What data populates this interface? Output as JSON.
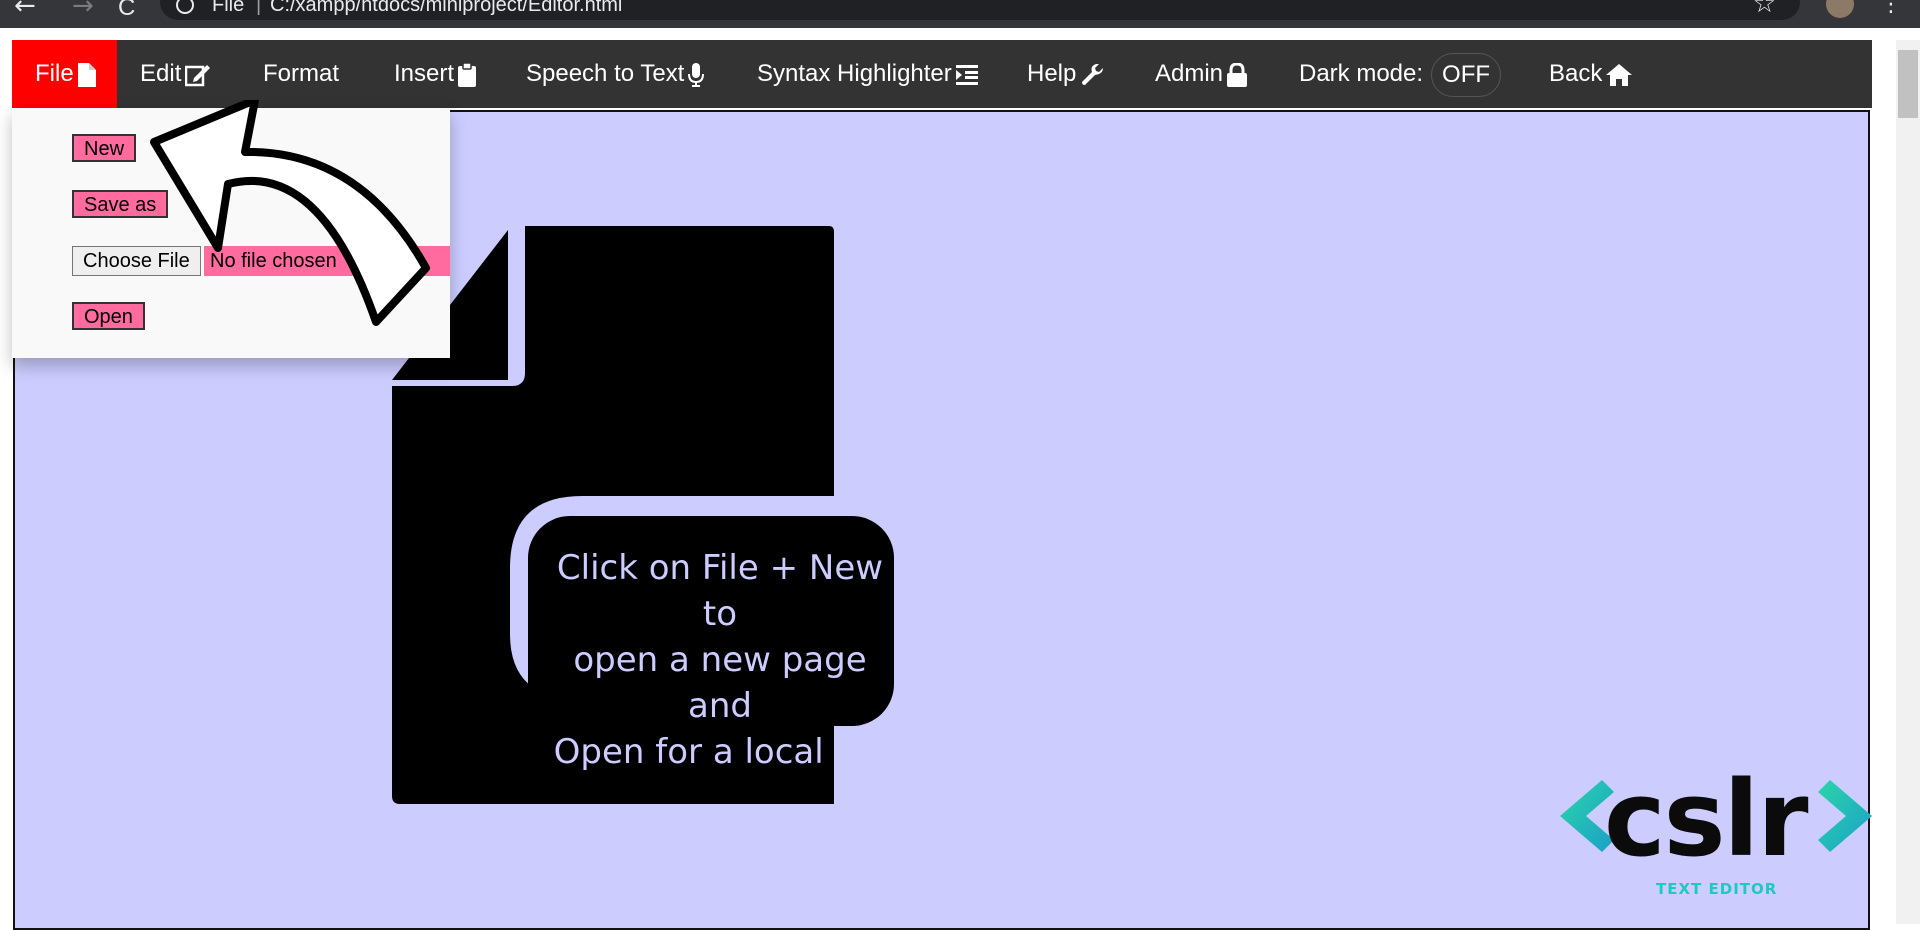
{
  "browser": {
    "back_glyph": "←",
    "forward_glyph": "→",
    "reload_glyph": "C",
    "scheme": "File",
    "separator": "|",
    "url": "C:/xampp/htdocs/miniproject/Editor.html",
    "star_glyph": "☆",
    "menu_glyph": "⋮"
  },
  "menubar": {
    "items": [
      {
        "label": "File",
        "icon": "file-icon"
      },
      {
        "label": "Edit",
        "icon": "edit-icon"
      },
      {
        "label": "Format",
        "icon": ""
      },
      {
        "label": "Insert",
        "icon": "clipboard-icon"
      },
      {
        "label": "Speech to Text",
        "icon": "microphone-icon"
      },
      {
        "label": "Syntax Highlighter",
        "icon": "indent-icon"
      },
      {
        "label": "Help",
        "icon": "wrench-icon"
      },
      {
        "label": "Admin",
        "icon": "lock-icon"
      },
      {
        "label": "Dark mode:",
        "icon": ""
      },
      {
        "label": "Back",
        "icon": "home-icon"
      }
    ],
    "dark_mode_value": "OFF",
    "active_color": "#ff0000",
    "bar_color": "#333333"
  },
  "file_menu": {
    "new_label": "New",
    "save_as_label": "Save as",
    "choose_file_label": "Choose File",
    "no_file_text": "No file chosen",
    "open_label": "Open",
    "button_color": "#ff6b9f"
  },
  "editor": {
    "background": "#ccccff",
    "hint_line1": "Click on File + New to",
    "hint_line2": "open a new page and",
    "hint_line3": "Open for a local file"
  },
  "logo": {
    "text": "cslr",
    "subtitle": "TEXT EDITOR",
    "accent": "#1fc8c0"
  }
}
